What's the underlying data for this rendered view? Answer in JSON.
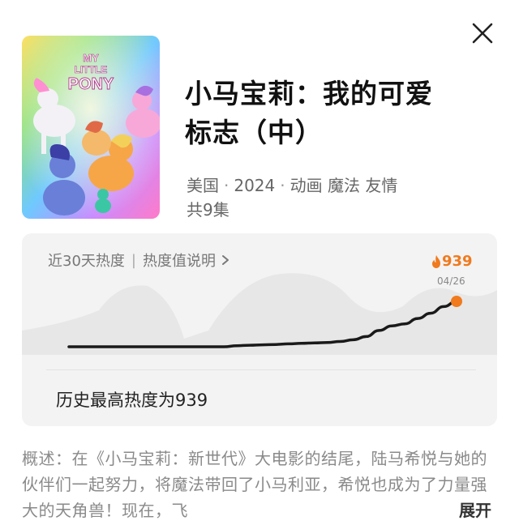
{
  "header": {
    "close_icon": "close-icon"
  },
  "show": {
    "title": "小马宝莉：我的可爱标志（中）",
    "country": "美国",
    "year": "2024",
    "genres": "动画 魔法 友情",
    "episodes": "共9集",
    "poster_logo_line1": "MY",
    "poster_logo_line2": "LITTLE",
    "poster_logo_line3": "PONY"
  },
  "heat": {
    "header_label": "近30天热度",
    "divider": "|",
    "info_link": "热度值说明",
    "value": "939",
    "date": "04/26",
    "history_text": "历史最高热度为939",
    "accent_color": "#f07a1d"
  },
  "chart_data": {
    "type": "line",
    "title": "",
    "xlabel": "",
    "ylabel": "",
    "series": [
      {
        "values": [
          40,
          40,
          40,
          40,
          40,
          40,
          40,
          40,
          40,
          40,
          40,
          40,
          40,
          41,
          42,
          43,
          44,
          46,
          48,
          50,
          52,
          58,
          70,
          100,
          180,
          260,
          300,
          420,
          560,
          760,
          939
        ]
      }
    ],
    "ylim": [
      0,
      1000
    ],
    "grid": false,
    "highlight_last_point": true
  },
  "summary": {
    "text": "概述：在《小马宝莉：新世代》大电影的结尾，陆马希悦与她的伙伴们一起努力，将魔法带回了小马利亚，希悦也成为了力量强大的天角兽！现在，飞",
    "expand_label": "展开"
  }
}
